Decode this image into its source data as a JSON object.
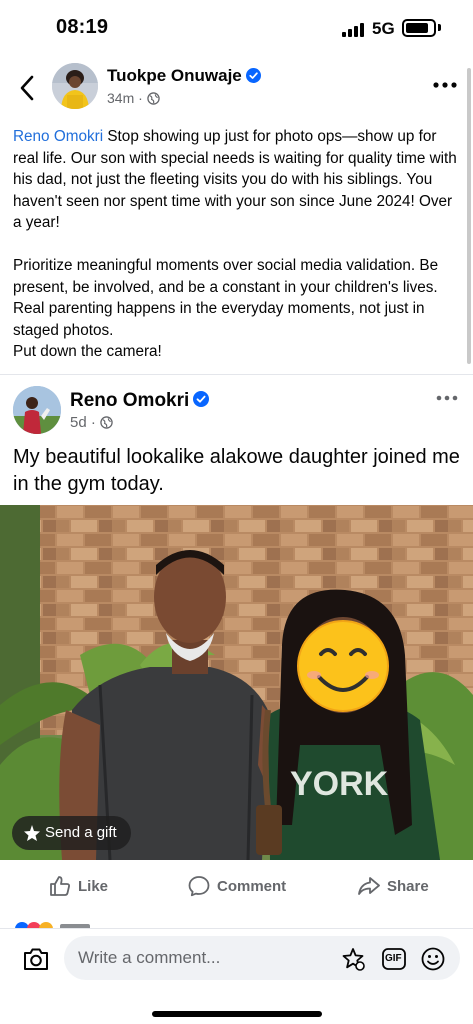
{
  "status_bar": {
    "time": "08:19",
    "network": "5G"
  },
  "post": {
    "author": "Tuokpe Onuwaje",
    "time": "34m",
    "mention": "Reno Omokri",
    "body": " Stop showing up just for photo ops—show up for real life. Our son with special needs is waiting for quality time with his dad, not just the fleeting visits you do with his siblings. You haven't seen nor spent time with your son since June 2024! Over a year!\n\nPrioritize meaningful moments over social media validation. Be present, be involved, and be a constant in your children's lives.\nReal parenting happens in the everyday moments, not just in staged photos.\nPut down the camera!"
  },
  "shared_post": {
    "author": "Reno Omokri",
    "time": "5d",
    "text": "My beautiful lookalike alakowe daughter joined me in the gym today.",
    "photo_caption_letters": "YORK",
    "send_gift_label": "Send a gift"
  },
  "actions": {
    "like": "Like",
    "comment": "Comment",
    "share": "Share"
  },
  "comment_bar": {
    "placeholder": "Write a comment...",
    "gif_label": "GIF"
  },
  "colors": {
    "link": "#216fdb",
    "verified": "#0866ff",
    "secondary_text": "#65676b"
  }
}
